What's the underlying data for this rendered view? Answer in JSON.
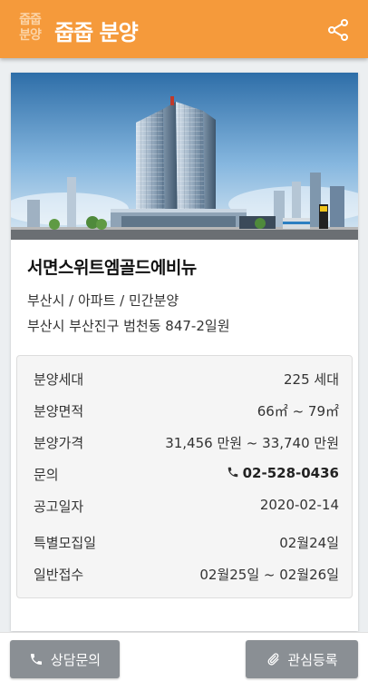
{
  "app": {
    "logo_line1": "줍줍",
    "logo_line2": "분양",
    "title": "줍줍 분양",
    "share_icon": "share-icon",
    "accent": "#f59a3b"
  },
  "property": {
    "name": "서면스위트엠골드에비뉴",
    "category": "부산시 / 아파트 / 민간분양",
    "address": "부산시 부산진구 범천동 847-2일원"
  },
  "info": {
    "rows": [
      {
        "label": "분양세대",
        "value": "225 세대"
      },
      {
        "label": "분양면적",
        "value": "66㎡ ~ 79㎡"
      },
      {
        "label": "분양가격",
        "value": "31,456 만원 ~ 33,740 만원"
      },
      {
        "label": "문의",
        "value": "02-528-0436"
      },
      {
        "label": "공고일자",
        "value": "2020-02-14"
      },
      {
        "label": "특별모집일",
        "value": "02월24일"
      },
      {
        "label": "일반접수",
        "value": "02월25일 ~ 02월26일"
      }
    ]
  },
  "bottom": {
    "consult_label": "상담문의",
    "favorite_label": "관심등록"
  }
}
